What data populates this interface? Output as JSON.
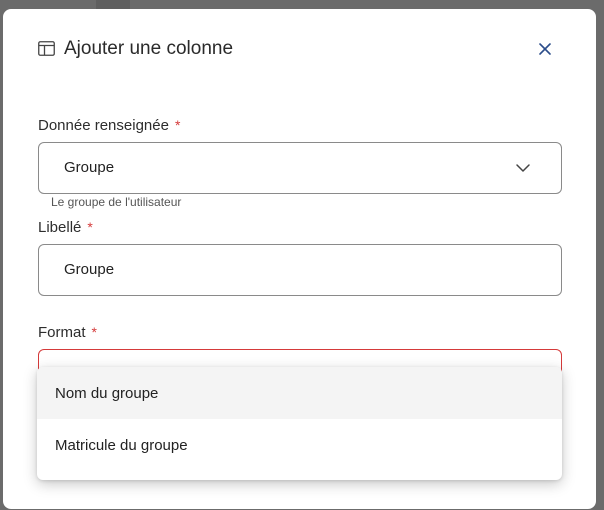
{
  "modal": {
    "title": "Ajouter une colonne",
    "title_icon": "table-columns-icon",
    "close_icon": "close-icon"
  },
  "fields": {
    "data": {
      "label": "Donnée renseignée",
      "required_marker": "*",
      "value": "Groupe",
      "hint": "Le groupe de l'utilisateur",
      "icon": "chevron-down-icon"
    },
    "label": {
      "label": "Libellé",
      "required_marker": "*",
      "value": "Groupe"
    },
    "format": {
      "label": "Format",
      "required_marker": "*",
      "value": ""
    }
  },
  "dropdown": {
    "options": [
      {
        "label": "Nom du groupe",
        "highlighted": true
      },
      {
        "label": "Matricule du groupe",
        "highlighted": false
      }
    ]
  },
  "colors": {
    "accent": "#2b4d8a",
    "required": "#d53a3a",
    "error_border": "#d53a3a"
  }
}
